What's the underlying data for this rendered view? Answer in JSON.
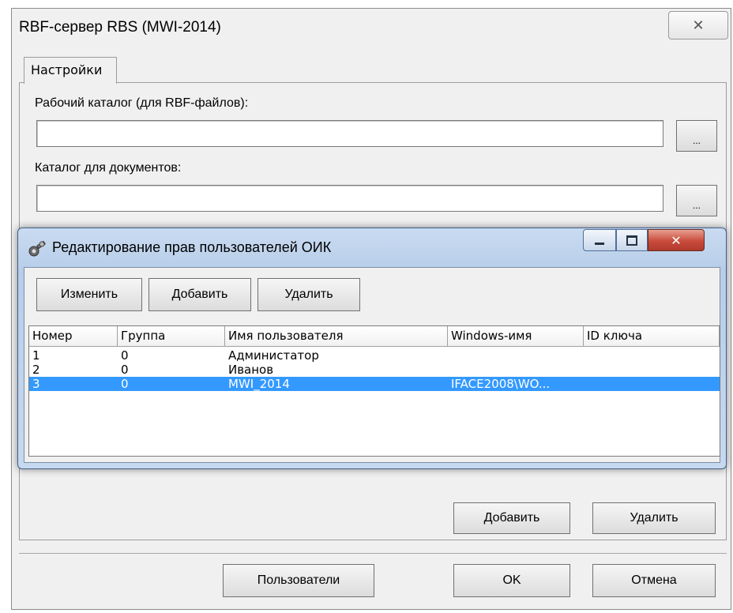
{
  "back_window": {
    "title": "RBF-сервер RBS (MWI-2014)",
    "close_glyph": "✕",
    "tab_label": "Настройки",
    "work_dir_label": "Рабочий каталог (для RBF-файлов):",
    "work_dir_value": "",
    "docs_dir_label": "Каталог для документов:",
    "docs_dir_value": "",
    "browse_label": "...",
    "add_label": "Добавить",
    "delete_label": "Удалить",
    "users_label": "Пользователи",
    "ok_label": "OK",
    "cancel_label": "Отмена"
  },
  "front_window": {
    "title": "Редактирование прав пользователей ОИК",
    "toolbar": {
      "edit_label": "Изменить",
      "add_label": "Добавить",
      "delete_label": "Удалить"
    },
    "columns": [
      "Номер",
      "Группа",
      "Имя пользователя",
      "Windows-имя",
      "ID ключа"
    ],
    "rows": [
      {
        "num": "1",
        "group": "0",
        "name": "Администатор",
        "win": "",
        "key": ""
      },
      {
        "num": "2",
        "group": "0",
        "name": "Иванов",
        "win": "",
        "key": ""
      },
      {
        "num": "3",
        "group": "0",
        "name": "MWI_2014",
        "win": "IFACE2008\\WO...",
        "key": ""
      }
    ],
    "selected_row": 3
  },
  "colors": {
    "selection": "#3399ff",
    "close_button": "#c94b3c",
    "front_frame": "#b7cde9"
  }
}
